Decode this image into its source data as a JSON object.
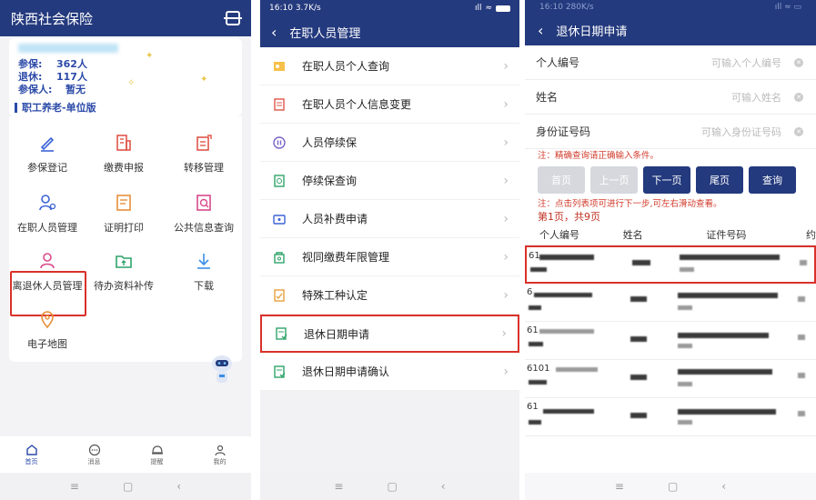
{
  "phone1": {
    "app_title": "陕西社会保险",
    "stats": {
      "insured_label": "参保:",
      "insured_value": "362人",
      "retired_label": "退休:",
      "retired_value": "117人",
      "worker_label": "参保人:",
      "worker_value": "暂无"
    },
    "section_title": "职工养老-单位版",
    "grid": [
      {
        "label": "参保登记",
        "icon": "pen-icon"
      },
      {
        "label": "缴费申报",
        "icon": "building-icon"
      },
      {
        "label": "转移管理",
        "icon": "transfer-doc-icon"
      },
      {
        "label": "在职人员管理",
        "icon": "user-gear-icon"
      },
      {
        "label": "证明打印",
        "icon": "certificate-icon"
      },
      {
        "label": "公共信息查询",
        "icon": "search-doc-icon"
      },
      {
        "label": "离退休人员管理",
        "icon": "retired-user-icon"
      },
      {
        "label": "待办资料补传",
        "icon": "folder-upload-icon"
      },
      {
        "label": "下载",
        "icon": "download-icon"
      },
      {
        "label": "电子地图",
        "icon": "map-pin-icon"
      }
    ],
    "tabs": [
      {
        "label": "首页",
        "icon": "home-icon"
      },
      {
        "label": "消息",
        "icon": "message-icon"
      },
      {
        "label": "提醒",
        "icon": "bell-icon"
      },
      {
        "label": "我的",
        "icon": "profile-icon"
      }
    ],
    "colors": {
      "primary": "#243a7e",
      "highlight": "#d9312a"
    }
  },
  "phone2": {
    "time": "16:10",
    "speed": "3.7K/s",
    "title": "在职人员管理",
    "menu": [
      {
        "label": "在职人员个人查询",
        "icon": "id-card-icon"
      },
      {
        "label": "在职人员个人信息变更",
        "icon": "edit-doc-icon"
      },
      {
        "label": "人员停续保",
        "icon": "pause-icon"
      },
      {
        "label": "停续保查询",
        "icon": "doc-search-icon"
      },
      {
        "label": "人员补费申请",
        "icon": "wallet-icon"
      },
      {
        "label": "视同缴费年限管理",
        "icon": "lock-doc-icon"
      },
      {
        "label": "特殊工种认定",
        "icon": "check-doc-icon"
      },
      {
        "label": "退休日期申请",
        "icon": "apply-doc-icon"
      },
      {
        "label": "退休日期申请确认",
        "icon": "confirm-doc-icon"
      }
    ]
  },
  "phone3": {
    "time": "16:10",
    "speed": "280K/s",
    "title": "退休日期申请",
    "fields": [
      {
        "label": "个人编号",
        "placeholder": "可输入个人编号"
      },
      {
        "label": "姓名",
        "placeholder": "可输入姓名"
      },
      {
        "label": "身份证号码",
        "placeholder": "可输入身份证号码"
      }
    ],
    "note1": "注：精确查询请正确输入条件。",
    "buttons": {
      "first": "首页",
      "prev": "上一页",
      "next": "下一页",
      "last": "尾页",
      "query": "查询"
    },
    "note2": "注：点击列表项可进行下一步,可左右滑动查看。",
    "page_info": "第1页，共9页",
    "columns": [
      "个人编号",
      "姓名",
      "证件号码",
      "约"
    ],
    "row_prefixes": [
      "61",
      "6",
      "61",
      "6101",
      "61"
    ]
  }
}
